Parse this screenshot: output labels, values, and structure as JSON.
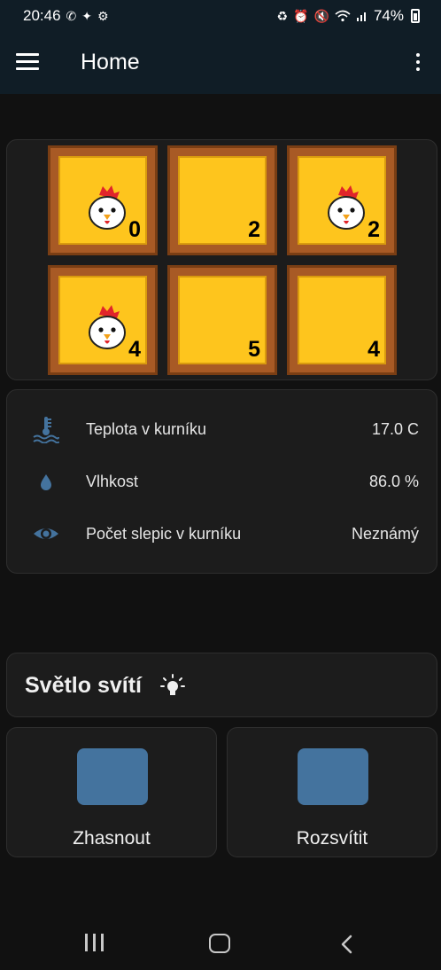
{
  "statusbar": {
    "time": "20:46",
    "battery": "74%",
    "left_icons": [
      "whatsapp-icon",
      "apps-icon",
      "settings-icon"
    ],
    "right_icons": [
      "recycle-icon",
      "alarm-icon",
      "mute-icon",
      "wifi-icon",
      "signal-icon",
      "battery-icon"
    ]
  },
  "topbar": {
    "title": "Home"
  },
  "tiles": [
    {
      "count": "0",
      "chicken": true
    },
    {
      "count": "2",
      "chicken": false
    },
    {
      "count": "2",
      "chicken": true
    },
    {
      "count": "4",
      "chicken": true
    },
    {
      "count": "5",
      "chicken": false
    },
    {
      "count": "4",
      "chicken": false
    }
  ],
  "sensors": [
    {
      "icon": "thermometer-water-icon",
      "label": "Teplota v kurníku",
      "value": "17.0 C"
    },
    {
      "icon": "water-drop-icon",
      "label": "Vlhkost",
      "value": "86.0 %"
    },
    {
      "icon": "eye-icon",
      "label": "Počet slepic v kurníku",
      "value": "Neznámý"
    }
  ],
  "light": {
    "title": "Světlo svítí",
    "icon": "lightbulb-on-icon"
  },
  "buttons": {
    "off_label": "Zhasnout",
    "on_label": "Rozsvítit"
  },
  "colors": {
    "header": "#101d26",
    "tile_frame": "#a85a25",
    "tile_fill": "#fec51d",
    "icon_blue": "#44739e",
    "background": "#111111",
    "card": "#1c1c1c"
  }
}
